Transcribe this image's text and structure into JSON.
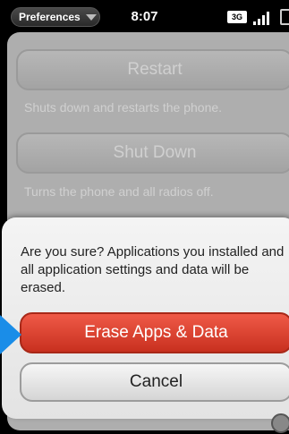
{
  "status_bar": {
    "app_menu": "Preferences",
    "time": "8:07",
    "network": "3G"
  },
  "settings": {
    "restart": {
      "label": "Restart",
      "description": "Shuts down and restarts the phone."
    },
    "shutdown": {
      "label": "Shut Down",
      "description": "Turns the phone and all radios off."
    }
  },
  "dialog": {
    "message": "Are you sure? Applications you installed and all application settings and data will be erased.",
    "confirm_label": "Erase Apps & Data",
    "cancel_label": "Cancel"
  },
  "icons": {
    "app_menu": "chevron-down-icon",
    "signal": "signal-bars-icon",
    "battery": "battery-icon",
    "pointer": "arrow-pointer-icon",
    "corner": "notification-icon"
  },
  "colors": {
    "confirm_button": "#d9402f",
    "pointer": "#1a8de8",
    "card_background": "#aeaeae"
  }
}
